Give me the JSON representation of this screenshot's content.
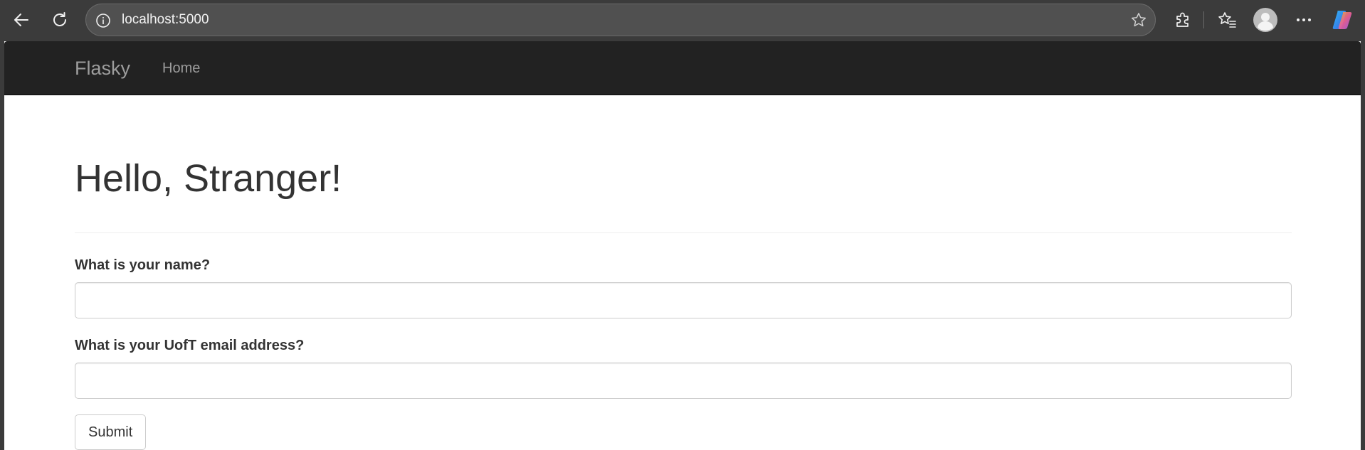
{
  "browser": {
    "address": "localhost:5000",
    "icons": {
      "back": "back-arrow-icon",
      "refresh": "refresh-icon",
      "site_info": "info-icon",
      "favorite": "star-icon",
      "extensions": "puzzle-icon",
      "favorites_list": "favorites-icon",
      "profile": "avatar-icon",
      "more": "more-dots-icon",
      "copilot": "copilot-icon"
    }
  },
  "navbar": {
    "brand": "Flasky",
    "links": [
      {
        "label": "Home"
      }
    ]
  },
  "page": {
    "heading": "Hello, Stranger!"
  },
  "form": {
    "name_label": "What is your name?",
    "name_value": "",
    "email_label": "What is your UofT email address?",
    "email_value": "",
    "submit_label": "Submit"
  },
  "colors": {
    "navbar_bg": "#222222",
    "navbar_text": "#9d9d9d",
    "heading_text": "#333333",
    "chrome_bg": "#3b3b3b",
    "address_bg": "#505050"
  }
}
